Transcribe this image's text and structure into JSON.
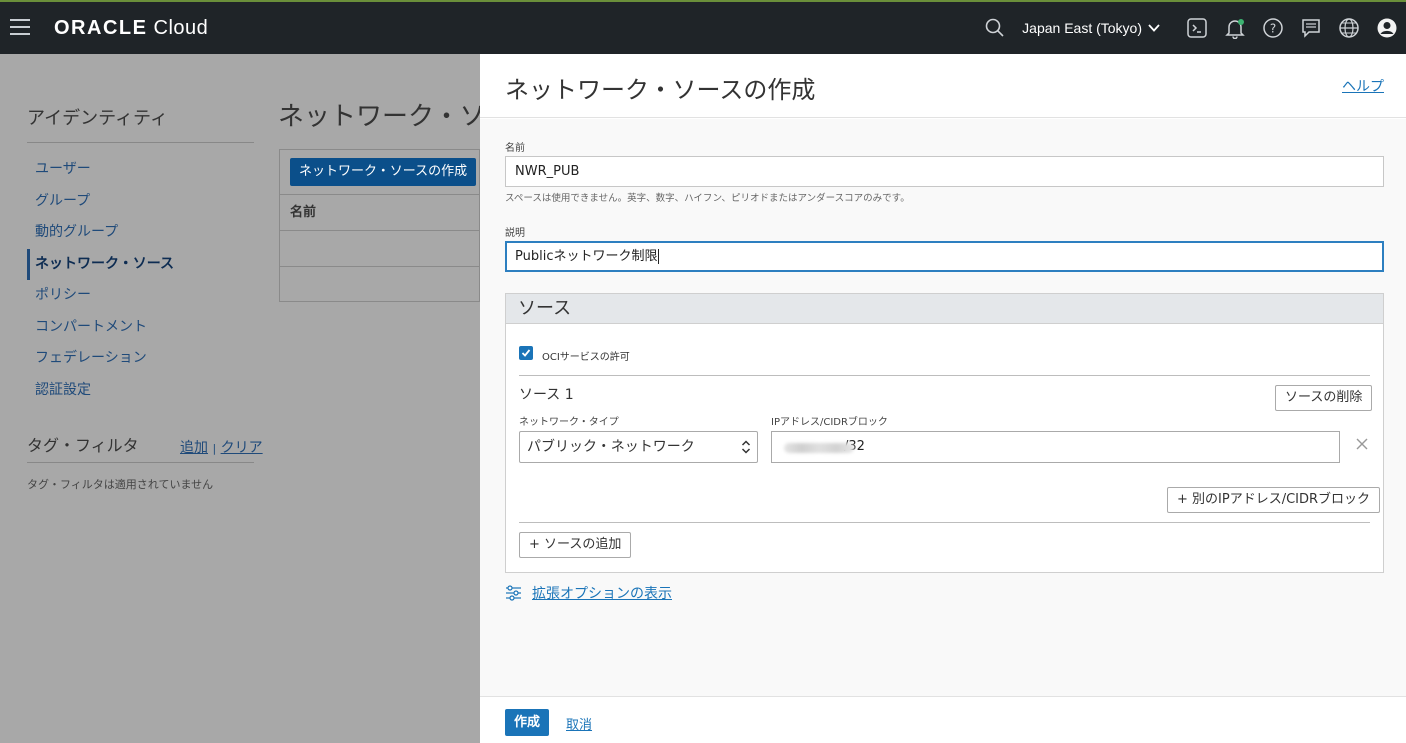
{
  "topbar": {
    "brand_strong": "ORACLE",
    "brand_light": " Cloud",
    "region": "Japan East (Tokyo)",
    "icons": [
      "search-icon",
      "chevron-down-icon",
      "cloud-shell-icon",
      "bell-icon",
      "help-icon",
      "chat-icon",
      "globe-icon",
      "user-icon"
    ]
  },
  "background": {
    "sidebar_title": "アイデンティティ",
    "sidebar_items": [
      {
        "label": "ユーザー"
      },
      {
        "label": "グループ"
      },
      {
        "label": "動的グループ"
      },
      {
        "label": "ネットワーク・ソース",
        "active": true
      },
      {
        "label": "ポリシー"
      },
      {
        "label": "コンパートメント"
      },
      {
        "label": "フェデレーション"
      },
      {
        "label": "認証設定"
      }
    ],
    "tag_filter_title": "タグ・フィルタ",
    "tag_add": "追加",
    "tag_sep": "|",
    "tag_clear": "クリア",
    "tag_note": "タグ・フィルタは適用されていません",
    "main_title": "ネットワーク・ソース",
    "create_button": "ネットワーク・ソースの作成",
    "table_header_name": "名前"
  },
  "panel": {
    "title": "ネットワーク・ソースの作成",
    "help": "ヘルプ",
    "name_label": "名前",
    "name_value": "NWR_PUB",
    "name_hint": "スペースは使用できません。英字、数字、ハイフン、ピリオドまたはアンダースコアのみです。",
    "desc_label": "説明",
    "desc_value": "Publicネットワーク制限",
    "sources_title": "ソース",
    "oci_checkbox_label": "OCIサービスの許可",
    "oci_checked": true,
    "source1_title": "ソース 1",
    "delete_source": "ソースの削除",
    "network_type_label": "ネットワーク・タイプ",
    "network_type_value": "パブリック・ネットワーク",
    "ip_label": "IPアドレス/CIDRブロック",
    "ip_value_suffix": "/32",
    "add_ip": "+ 別のIPアドレス/CIDRブロック",
    "add_source": "+ ソースの追加",
    "advanced": "拡張オプションの表示",
    "create": "作成",
    "cancel": "取消"
  }
}
